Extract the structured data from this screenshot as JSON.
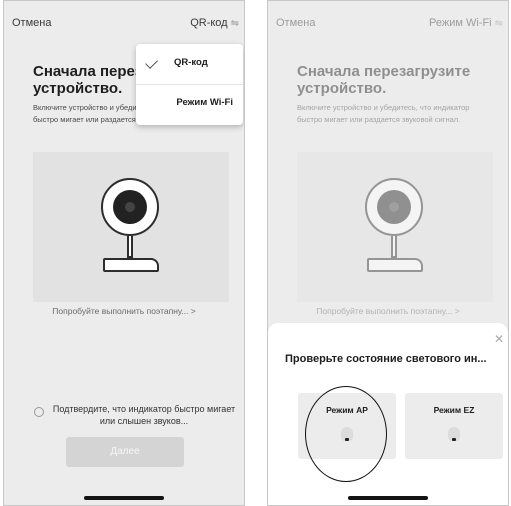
{
  "left_screen": {
    "cancel_label": "Отмена",
    "mode_label": "QR-код",
    "mode_icon": "swap-icon",
    "heading": "Сначала перезагрузите устройство.",
    "description": "Включите устройство и убедитесь, что индикатор быстро мигает или раздается звуковой сигнал.",
    "hint_link": "Попробуйте выполнить поэтапну... >",
    "confirm_text": "Подтвердите, что индикатор быстро мигает или слышен звуков...",
    "next_button": "Далее",
    "dropdown": {
      "items": [
        {
          "label": "QR-код",
          "selected": true
        },
        {
          "label": "Режим Wi-Fi",
          "selected": false
        }
      ]
    }
  },
  "right_screen": {
    "cancel_label": "Отмена",
    "mode_label": "Режим Wi-Fi",
    "mode_icon": "swap-icon",
    "heading": "Сначала перезагрузите устройство.",
    "description": "Включите устройство и убедитесь, что индикатор быстро мигает или раздается звуковой сигнал.",
    "hint_link": "Попробуйте выполнить поэтапну... >",
    "sheet": {
      "close_icon": "close-icon",
      "title": "Проверьте состояние светового ин...",
      "modes": [
        {
          "label": "Режим AP",
          "highlighted": true
        },
        {
          "label": "Режим EZ",
          "highlighted": false
        }
      ]
    }
  },
  "colors": {
    "screen_bg": "#ececec",
    "sheet_bg": "#ffffff",
    "text_dark": "#1e1e1e",
    "button_disabled": "#d4d4d4"
  }
}
